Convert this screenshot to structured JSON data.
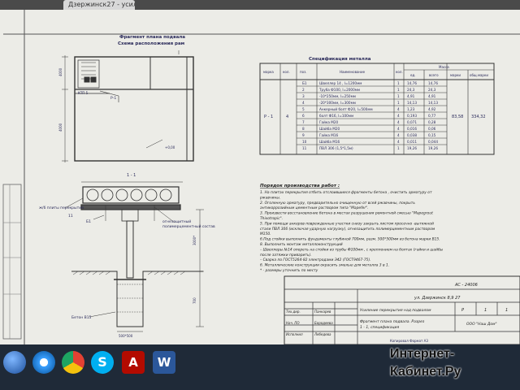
{
  "browser": {
    "tab_title": "Дзержинск27 - усил..."
  },
  "drawing": {
    "plan_title": "Фрагмент плана подвала",
    "plan_subtitle": "Схема расположения рам",
    "plan_labels": {
      "p1": "Р-1",
      "mark": "+0,00",
      "left_dim_top": "4000",
      "left_dim_bottom": "4000",
      "ktp": "КТП 5"
    },
    "section_title": "1 - 1",
    "section_labels": {
      "perekr": "ж/б плиты перекрытия",
      "b1": "Б1",
      "p11": "11",
      "comp1": "огнезащитный",
      "comp2": "полимерцементный состав",
      "dim_top": "3000*",
      "dim_bottom": "700",
      "beton": "Бетон В15",
      "dim_base": "500*500"
    },
    "spec": {
      "title": "Спецификация металла",
      "headers": {
        "mark": "марка",
        "kol": "кол.",
        "poz": "поз.",
        "name": "Наименование",
        "kolvo": "кол.",
        "mass": "Масса",
        "ed": "ед.",
        "vsego": "всего",
        "marki": "марки",
        "obsh": "общ.марки"
      },
      "mark_value": "Р - 1",
      "kol_value": "4",
      "mass_marki": "83,58",
      "mass_obsh": "334,32",
      "rows": [
        {
          "poz": "Б1",
          "name": "Швеллер 14 , l=1200мм",
          "kol": "1",
          "ed": "14,76",
          "vsego": "14,76"
        },
        {
          "poz": "2",
          "name": "Труба Ф100, l=2000мм",
          "kol": "1",
          "ed": "24,3",
          "vsego": "24,3"
        },
        {
          "poz": "3",
          "name": "-10*250мм, l=250мм",
          "kol": "1",
          "ed": "4,91",
          "vsego": "4,91"
        },
        {
          "poz": "4",
          "name": "-20*300мм, l=300мм",
          "kol": "1",
          "ed": "14,13",
          "vsego": "14,13"
        },
        {
          "poz": "5",
          "name": "Анкерный болт Ф20, l=500мм",
          "kol": "4",
          "ed": "1,23",
          "vsego": "4,92"
        },
        {
          "poz": "6",
          "name": "болт Ф16, l=100мм",
          "kol": "4",
          "ed": "0,193",
          "vsego": "0,77"
        },
        {
          "poz": "7",
          "name": "Гайка М20",
          "kol": "4",
          "ed": "0,071",
          "vsego": "0,28"
        },
        {
          "poz": "8",
          "name": "Шайба М20",
          "kol": "4",
          "ed": "0,016",
          "vsego": "0,06"
        },
        {
          "poz": "9",
          "name": "Гайка М16",
          "kol": "4",
          "ed": "0,038",
          "vsego": "0,15"
        },
        {
          "poz": "10",
          "name": "Шайба М16",
          "kol": "4",
          "ed": "0,011",
          "vsego": "0,044"
        },
        {
          "poz": "11",
          "name": "ПВЛ 306 (1,5*1,5м)",
          "kol": "1",
          "ed": "19,26",
          "vsego": "19,26"
        }
      ]
    },
    "notes": {
      "title": "Порядок производства работ :",
      "lines": [
        "1. На плитах перекрытия отбить отслоившиеся фрагменты бетона , очистить арматуру от",
        "ржавчины.",
        "2. Оголенную арматуру, предварительно очищенную от всей ржавчины, покрыть",
        "антикоррозийным цементным раствором типа \"Mapefer\".",
        "3. Произвести восстановление бетона в местах разрушения ремонтной смесью \"Mapegrout",
        "Thixotropic\".",
        "5. При помощи анкеров поврежденные участки снизу закрыть листом просечно -вытяжной",
        "стали ПВЛ 306 (исключая ударную нагрузку), огнезащитить полимерцементным раствором",
        "М150.",
        "6.Под стойки выполнить фундаменты глубиной 700мм, разм. 500*500мм из бетона марки В15.",
        "8. Выполнить монтаж металлоконструкций",
        "– Швеллеры №14 опереть на стойки из трубы Ф100мм , с креплением на болтах (гайки и шайбы",
        "после затяжки приварить).",
        "– Сварка по ГОСТ5264-82 электродами Э42 (ГОСТ9467-75).",
        "6. Металлические конструкции окрасить эмалью для металла 3 в 1.",
        "* - размеры уточнить по месту"
      ]
    },
    "stamp": {
      "code": "АС - 24006",
      "address": "ул. Дзержинск 8,9 27",
      "object": "Усиление перекрытия над подвалом",
      "sheet_name_1": "Фрагмент плана подвала. Разрез",
      "sheet_name_2": "1 - 1, спецификация",
      "stage": "Р",
      "sheet": "1",
      "sheets": "1",
      "org": "ООО \"Наш Дом\"",
      "roles": [
        {
          "role": "Тех.дир.",
          "name": "Панкарев"
        },
        {
          "role": "Нач. ПО",
          "name": "Бородеева"
        },
        {
          "role": "Исполнил",
          "name": "Лебедева"
        }
      ],
      "format": "Копировал    Формат А3"
    }
  },
  "watermark": {
    "line1": "Интернет-",
    "line2": "Кабинет.Ру"
  },
  "taskbar_icons": [
    "start-orb-icon",
    "ie-icon",
    "chrome-icon",
    "skype-icon",
    "acrobat-icon",
    "word-icon"
  ]
}
